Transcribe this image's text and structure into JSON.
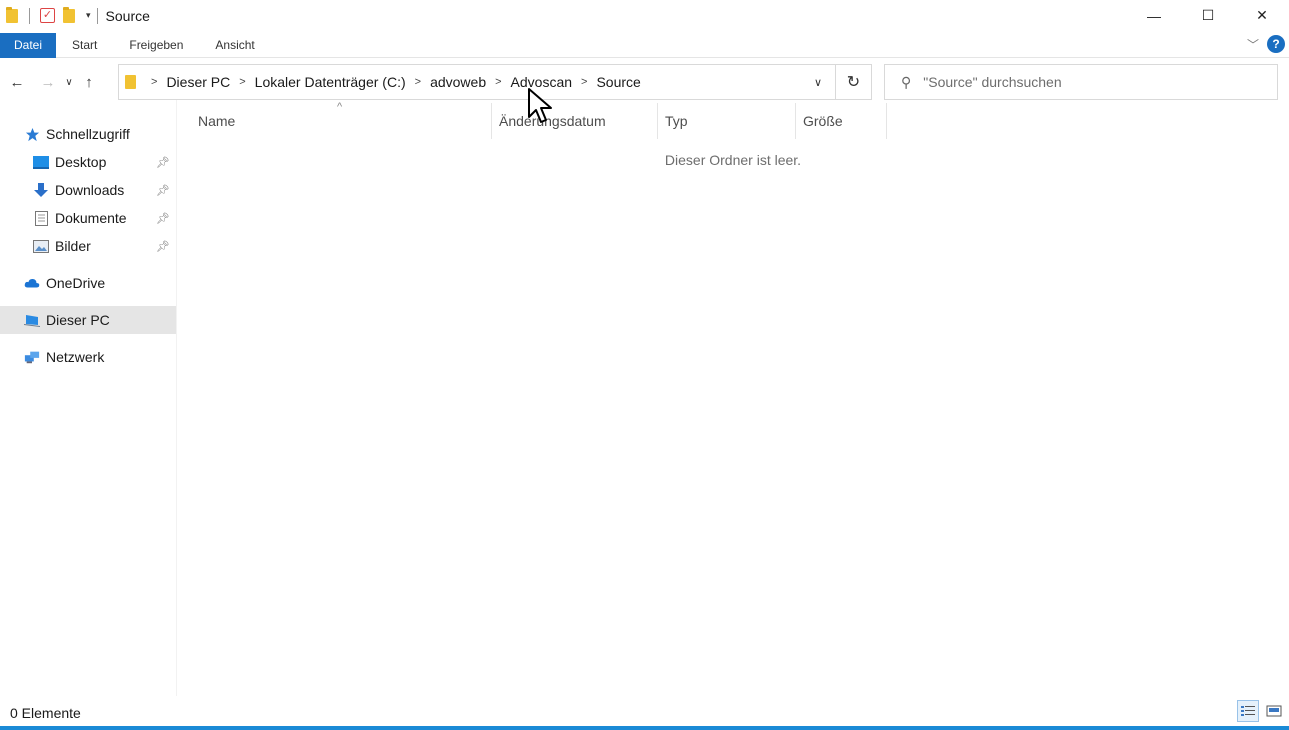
{
  "window": {
    "title": "Source",
    "minimize_glyph": "—",
    "maximize_glyph": "☐",
    "close_glyph": "✕"
  },
  "ribbon": {
    "tabs": [
      {
        "label": "Datei"
      },
      {
        "label": "Start"
      },
      {
        "label": "Freigeben"
      },
      {
        "label": "Ansicht"
      }
    ],
    "help_label": "?"
  },
  "navigation": {
    "breadcrumbs": [
      "Dieser PC",
      "Lokaler Datenträger (C:)",
      "advoweb",
      "Advoscan",
      "Source"
    ],
    "search_placeholder": "\"Source\" durchsuchen"
  },
  "sidebar": {
    "quick_access": {
      "label": "Schnellzugriff",
      "icon": "star-icon"
    },
    "pinned": [
      {
        "label": "Desktop",
        "icon": "desktop-icon"
      },
      {
        "label": "Downloads",
        "icon": "download-arrow-icon"
      },
      {
        "label": "Dokumente",
        "icon": "document-icon"
      },
      {
        "label": "Bilder",
        "icon": "pictures-icon"
      }
    ],
    "onedrive": {
      "label": "OneDrive",
      "icon": "cloud-icon"
    },
    "this_pc": {
      "label": "Dieser PC",
      "icon": "computer-icon",
      "selected": true
    },
    "network": {
      "label": "Netzwerk",
      "icon": "network-icon"
    }
  },
  "content": {
    "columns": {
      "name": "Name",
      "date": "Änderungsdatum",
      "type": "Typ",
      "size": "Größe"
    },
    "empty_message": "Dieser Ordner ist leer."
  },
  "statusbar": {
    "item_count": "0 Elemente"
  },
  "colors": {
    "accent": "#1a6ec1",
    "folder": "#f1c232",
    "selection": "#e5e5e5"
  }
}
